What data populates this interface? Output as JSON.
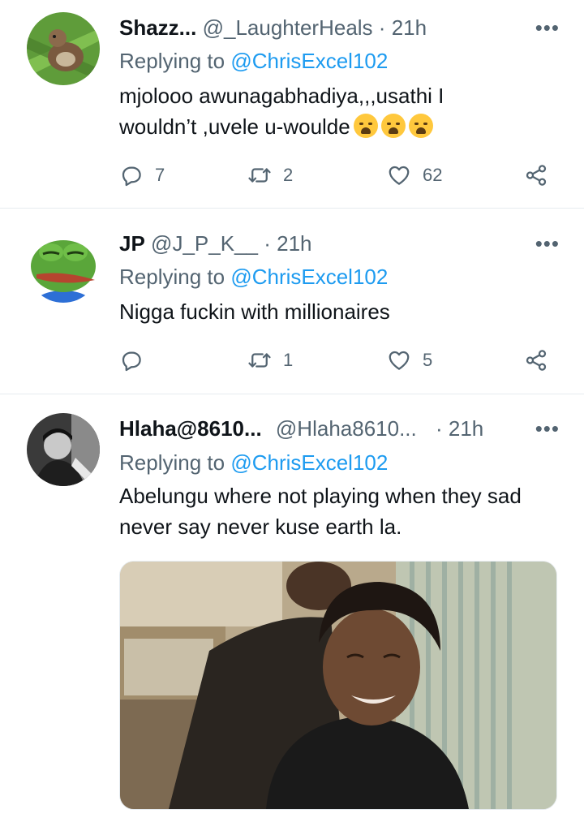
{
  "tweets": [
    {
      "name": "Shazz...",
      "handle": "@_LaughterHeals",
      "time": "21h",
      "replying_prefix": "Replying to ",
      "replying_to": "@ChrisExcel102",
      "text_line1": "mjolooo awunagabhadiya,,,usathi I",
      "text_line2": "wouldn’t ,uvele u-woulde",
      "emoji": "loudly-crying-face",
      "replies": "7",
      "retweets": "2",
      "likes": "62"
    },
    {
      "name": "JP",
      "handle": "@J_P_K__",
      "time": "21h",
      "replying_prefix": "Replying to ",
      "replying_to": "@ChrisExcel102",
      "text": "Nigga fuckin with millionaires",
      "replies": "",
      "retweets": "1",
      "likes": "5"
    },
    {
      "name": "Hlaha@8610...",
      "handle": "@Hlaha8610...",
      "time": "21h",
      "replying_prefix": "Replying to ",
      "replying_to": "@ChrisExcel102",
      "text_line1": "Abelungu where not playing when they sad",
      "text_line2": "never say never kuse earth la.",
      "media": "photo"
    }
  ],
  "separator": "·",
  "more_glyph": "•••",
  "colors": {
    "text": "#0f1419",
    "secondary": "#536471",
    "link": "#1d9bf0",
    "border": "#e6ecf0"
  }
}
